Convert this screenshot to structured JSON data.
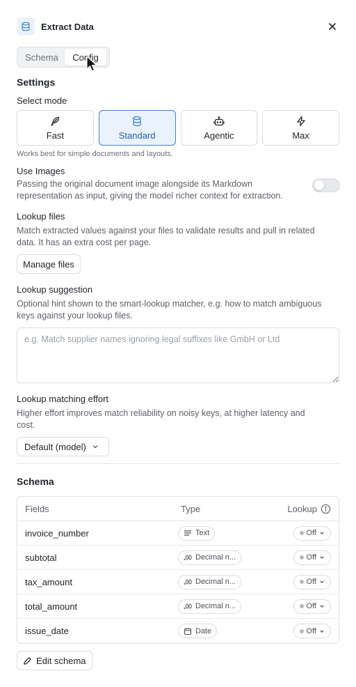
{
  "header": {
    "title": "Extract Data",
    "icon": "database-icon",
    "close_icon": "close-icon"
  },
  "tabs": [
    {
      "label": "Schema",
      "active": false
    },
    {
      "label": "Config",
      "active": true
    }
  ],
  "settings": {
    "title": "Settings",
    "select_mode_label": "Select mode",
    "modes": [
      {
        "label": "Fast",
        "icon": "feather-icon",
        "active": false
      },
      {
        "label": "Standard",
        "icon": "database-icon",
        "active": true
      },
      {
        "label": "Agentic",
        "icon": "robot-icon",
        "active": false
      },
      {
        "label": "Max",
        "icon": "lightning-icon",
        "active": false
      }
    ],
    "mode_hint": "Works best for simple documents and layouts.",
    "use_images": {
      "label": "Use Images",
      "desc_line1": "Passing the original document image alongside its Markdown",
      "desc_line2": "representation as input, giving the model richer context for extraction.",
      "enabled": false
    },
    "lookup_files": {
      "label": "Lookup files",
      "desc_line1": "Match extracted values against your files to validate results and pull in related",
      "desc_line2": "data. It has an extra cost per page.",
      "button": "Manage files"
    },
    "lookup_suggestion": {
      "label": "Lookup suggestion",
      "desc_line1": "Optional hint shown to the smart-lookup matcher, e.g. how to match ambiguous",
      "desc_line2": "keys against your lookup files.",
      "placeholder": "e.g. Match supplier names ignoring legal suffixes like GmbH or Ltd",
      "value": ""
    },
    "lookup_effort": {
      "label": "Lookup matching effort",
      "desc_line1": "Higher effort improves match reliability on noisy keys, at higher latency and",
      "desc_line2": "cost.",
      "selected": "Default (model)"
    }
  },
  "schema": {
    "title": "Schema",
    "columns": {
      "fields": "Fields",
      "type": "Type",
      "lookup": "Lookup"
    },
    "rows": [
      {
        "field": "invoice_number",
        "type": "Text",
        "type_icon": "text-lines-icon",
        "lookup": "Off"
      },
      {
        "field": "subtotal",
        "type": "Decimal n...",
        "type_icon": "decimal-icon",
        "lookup": "Off"
      },
      {
        "field": "tax_amount",
        "type": "Decimal n...",
        "type_icon": "decimal-icon",
        "lookup": "Off"
      },
      {
        "field": "total_amount",
        "type": "Decimal n...",
        "type_icon": "decimal-icon",
        "lookup": "Off"
      },
      {
        "field": "issue_date",
        "type": "Date",
        "type_icon": "calendar-icon",
        "lookup": "Off"
      }
    ],
    "edit_button": "Edit schema"
  },
  "colors": {
    "accent": "#3b82d6",
    "accent_bg": "#eaf2fd",
    "border": "#d9dcdf",
    "text": "#1f2328",
    "muted": "#5d6168"
  }
}
